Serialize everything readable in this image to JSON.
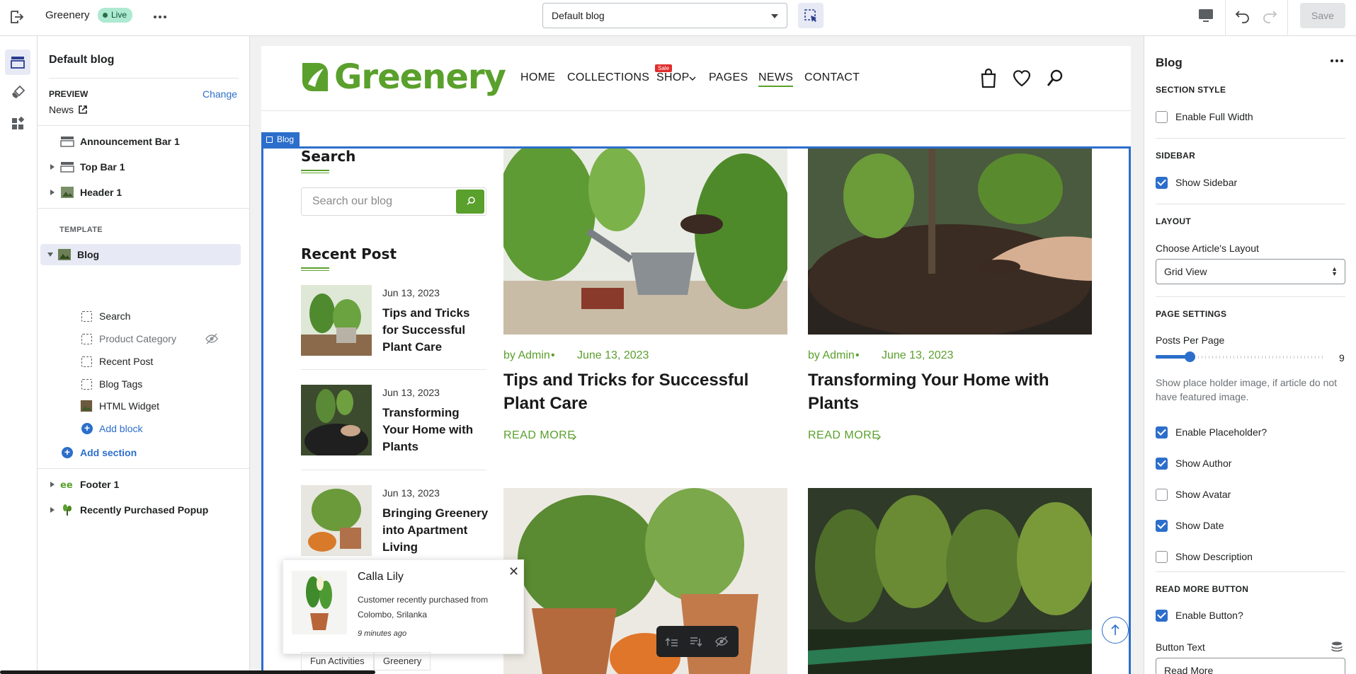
{
  "topbar": {
    "store_name": "Greenery",
    "live_label": "Live",
    "template_select": "Default blog",
    "save_label": "Save"
  },
  "left_panel": {
    "title": "Default blog",
    "preview_label": "PREVIEW",
    "change_label": "Change",
    "preview_page": "News",
    "header_sections": [
      {
        "label": "Announcement Bar 1"
      },
      {
        "label": "Top Bar 1"
      },
      {
        "label": "Header 1"
      }
    ],
    "template_label": "TEMPLATE",
    "template_section": "Blog",
    "blocks": [
      {
        "label": "Search"
      },
      {
        "label": "Product Category"
      },
      {
        "label": "Recent Post"
      },
      {
        "label": "Blog Tags"
      },
      {
        "label": "HTML Widget"
      }
    ],
    "add_block": "Add block",
    "add_section": "Add section",
    "footer_sections": [
      {
        "label": "Footer 1"
      },
      {
        "label": "Recently Purchased Popup"
      }
    ]
  },
  "site": {
    "logo": "Greenery",
    "nav": [
      "HOME",
      "COLLECTIONS",
      "SHOP",
      "PAGES",
      "NEWS",
      "CONTACT"
    ],
    "sale_badge": "Sale",
    "section_tag": "Blog",
    "search_heading": "Search",
    "search_placeholder": "Search our blog",
    "recent_heading": "Recent Post",
    "recent_posts": [
      {
        "date": "Jun 13, 2023",
        "title": "Tips and Tricks for Successful Plant Care"
      },
      {
        "date": "Jun 13, 2023",
        "title": "Transforming Your Home with Plants"
      },
      {
        "date": "Jun 13, 2023",
        "title": "Bringing Greenery into Apartment Living"
      }
    ],
    "articles": [
      {
        "author": "by Admin",
        "date": "June 13, 2023",
        "title": "Tips and Tricks for Successful Plant Care",
        "read_more": "READ MORE"
      },
      {
        "author": "by Admin",
        "date": "June 13, 2023",
        "title": "Transforming Your Home with Plants",
        "read_more": "READ MORE"
      }
    ],
    "popup": {
      "product": "Calla Lily",
      "text": "Customer recently purchased  from Colombo, Srilanka",
      "time": "9 minutes ago"
    },
    "tags": [
      "Fun Activities",
      "Greenery"
    ]
  },
  "right_panel": {
    "title": "Blog",
    "section_style": "SECTION STYLE",
    "enable_full_width": "Enable Full Width",
    "sidebar_heading": "SIDEBAR",
    "show_sidebar": "Show Sidebar",
    "layout_heading": "LAYOUT",
    "choose_layout": "Choose Article's Layout",
    "layout_value": "Grid View",
    "page_settings": "PAGE SETTINGS",
    "posts_per_page": "Posts Per Page",
    "posts_per_page_value": "9",
    "posts_per_page_level": 0.2,
    "placeholder_help": "Show place holder image, if article do not have featured image.",
    "options": [
      {
        "label": "Enable Placeholder?",
        "checked": true
      },
      {
        "label": "Show Author",
        "checked": true
      },
      {
        "label": "Show Avatar",
        "checked": false
      },
      {
        "label": "Show Date",
        "checked": true
      },
      {
        "label": "Show Description",
        "checked": false
      }
    ],
    "read_more_heading": "READ MORE BUTTON",
    "enable_button": "Enable Button?",
    "button_text_label": "Button Text",
    "button_text_value": "Read More"
  },
  "colors": {
    "accent": "#2c6ecb",
    "brand_green": "#5aa02c",
    "live_badge": "#aee9d1",
    "sale_red": "#e02d2d"
  }
}
